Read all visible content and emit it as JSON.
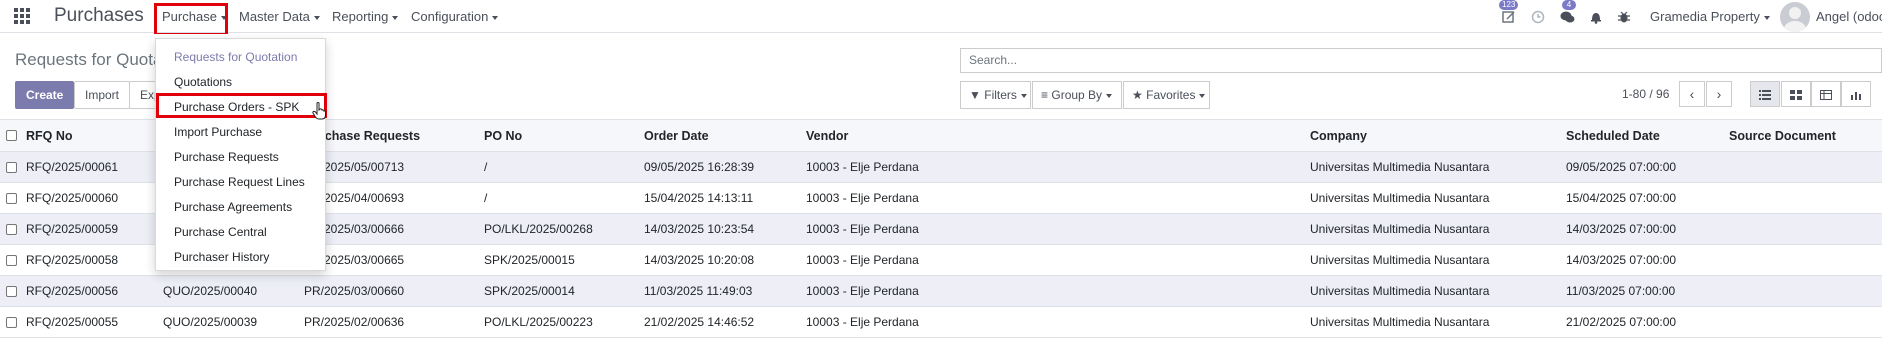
{
  "navbar": {
    "brand": "Purchases",
    "menus": {
      "purchase": "Purchase",
      "master_data": "Master Data",
      "reporting": "Reporting",
      "configuration": "Configuration"
    },
    "activity_badge": "123",
    "messages_badge": "4",
    "company": "Gramedia Property",
    "user": "Angel (odoo"
  },
  "control_panel": {
    "breadcrumb": "Requests for Quotation",
    "create_label": "Create",
    "import_label": "Import",
    "export_label": "Export",
    "search_placeholder": "Search...",
    "filters_label": "Filters",
    "group_by_label": "Group By",
    "favorites_label": "Favorites",
    "pager": "1-80 / 96"
  },
  "dropdown": {
    "items": [
      "Requests for Quotation",
      "Quotations",
      "Purchase Orders - SPK",
      "Import Purchase",
      "Purchase Requests",
      "Purchase Request Lines",
      "Purchase Agreements",
      "Purchase Central",
      "Purchaser History"
    ]
  },
  "table": {
    "columns": {
      "rfq": "RFQ No",
      "quo": "",
      "pr": "Purchase Requests",
      "po": "PO No",
      "date": "Order Date",
      "vendor": "Vendor",
      "company": "Company",
      "sched": "Scheduled Date",
      "source": "Source Document"
    },
    "rows": [
      {
        "rfq": "RFQ/2025/00061",
        "quo": "",
        "pr": "PR/2025/05/00713",
        "po": "/",
        "date": "09/05/2025 16:28:39",
        "vendor": "10003 - Elje Perdana",
        "company": "Universitas Multimedia Nusantara",
        "sched": "09/05/2025 07:00:00",
        "source": ""
      },
      {
        "rfq": "RFQ/2025/00060",
        "quo": "",
        "pr": "PR/2025/04/00693",
        "po": "/",
        "date": "15/04/2025 14:13:11",
        "vendor": "10003 - Elje Perdana",
        "company": "Universitas Multimedia Nusantara",
        "sched": "15/04/2025 07:00:00",
        "source": ""
      },
      {
        "rfq": "RFQ/2025/00059",
        "quo": "",
        "pr": "PR/2025/03/00666",
        "po": "PO/LKL/2025/00268",
        "date": "14/03/2025 10:23:54",
        "vendor": "10003 - Elje Perdana",
        "company": "Universitas Multimedia Nusantara",
        "sched": "14/03/2025 07:00:00",
        "source": ""
      },
      {
        "rfq": "RFQ/2025/00058",
        "quo": "",
        "pr": "PR/2025/03/00665",
        "po": "SPK/2025/00015",
        "date": "14/03/2025 10:20:08",
        "vendor": "10003 - Elje Perdana",
        "company": "Universitas Multimedia Nusantara",
        "sched": "14/03/2025 07:00:00",
        "source": ""
      },
      {
        "rfq": "RFQ/2025/00056",
        "quo": "QUO/2025/00040",
        "pr": "PR/2025/03/00660",
        "po": "SPK/2025/00014",
        "date": "11/03/2025 11:49:03",
        "vendor": "10003 - Elje Perdana",
        "company": "Universitas Multimedia Nusantara",
        "sched": "11/03/2025 07:00:00",
        "source": ""
      },
      {
        "rfq": "RFQ/2025/00055",
        "quo": "QUO/2025/00039",
        "pr": "PR/2025/02/00636",
        "po": "PO/LKL/2025/00223",
        "date": "21/02/2025 14:46:52",
        "vendor": "10003 - Elje Perdana",
        "company": "Universitas Multimedia Nusantara",
        "sched": "21/02/2025 07:00:00",
        "source": ""
      }
    ]
  }
}
